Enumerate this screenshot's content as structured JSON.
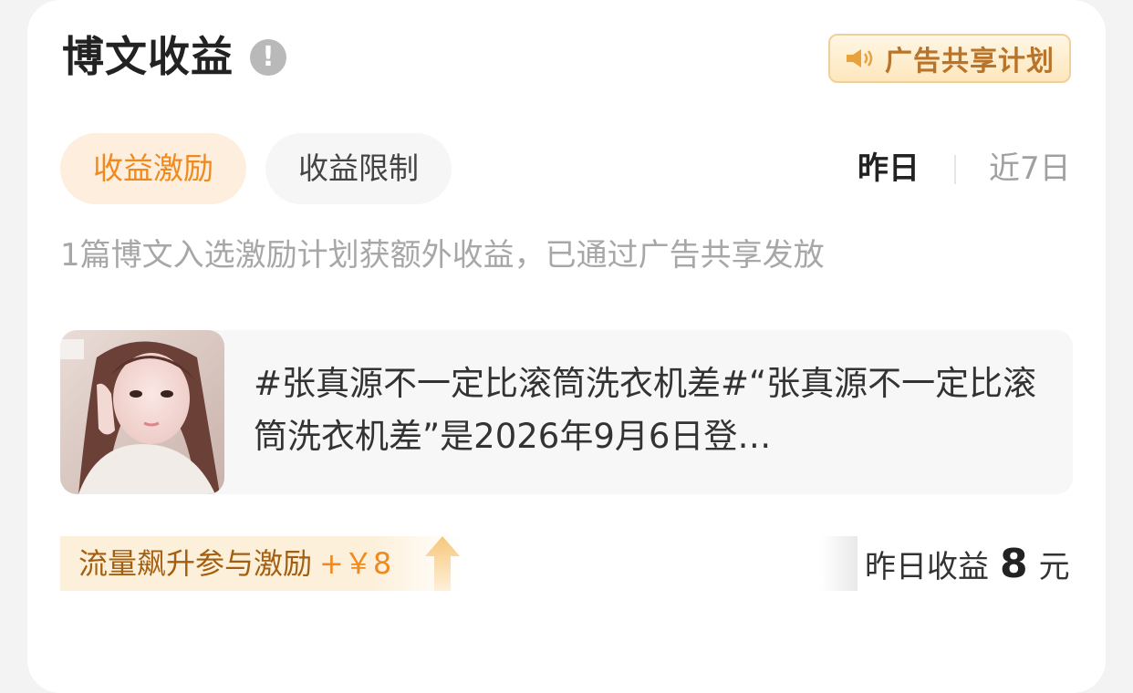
{
  "header": {
    "title": "博文收益",
    "info_icon": "exclamation-circle-icon",
    "ad_badge_label": "广告共享计划",
    "ad_badge_icon": "speaker-icon"
  },
  "tabs": [
    {
      "label": "收益激励",
      "active": true
    },
    {
      "label": "收益限制",
      "active": false
    }
  ],
  "period": {
    "yesterday": "昨日",
    "last7days": "近7日",
    "selected": "昨日"
  },
  "subtitle": "1篇博文入选激励计划获额外收益，已通过广告共享发放",
  "post": {
    "text": "#张真源不一定比滚筒洗衣机差#“张真源不一定比滚筒洗衣机差”是2026年9月6日登…"
  },
  "boost": {
    "label": "流量飙升参与激励",
    "amount": "+￥8",
    "icon": "up-arrow-icon"
  },
  "earnings": {
    "label": "昨日收益",
    "value": "8",
    "unit": "元"
  },
  "colors": {
    "accent": "#f08a1e",
    "badge_text": "#b8742a",
    "muted_text": "#a7a7a7"
  }
}
